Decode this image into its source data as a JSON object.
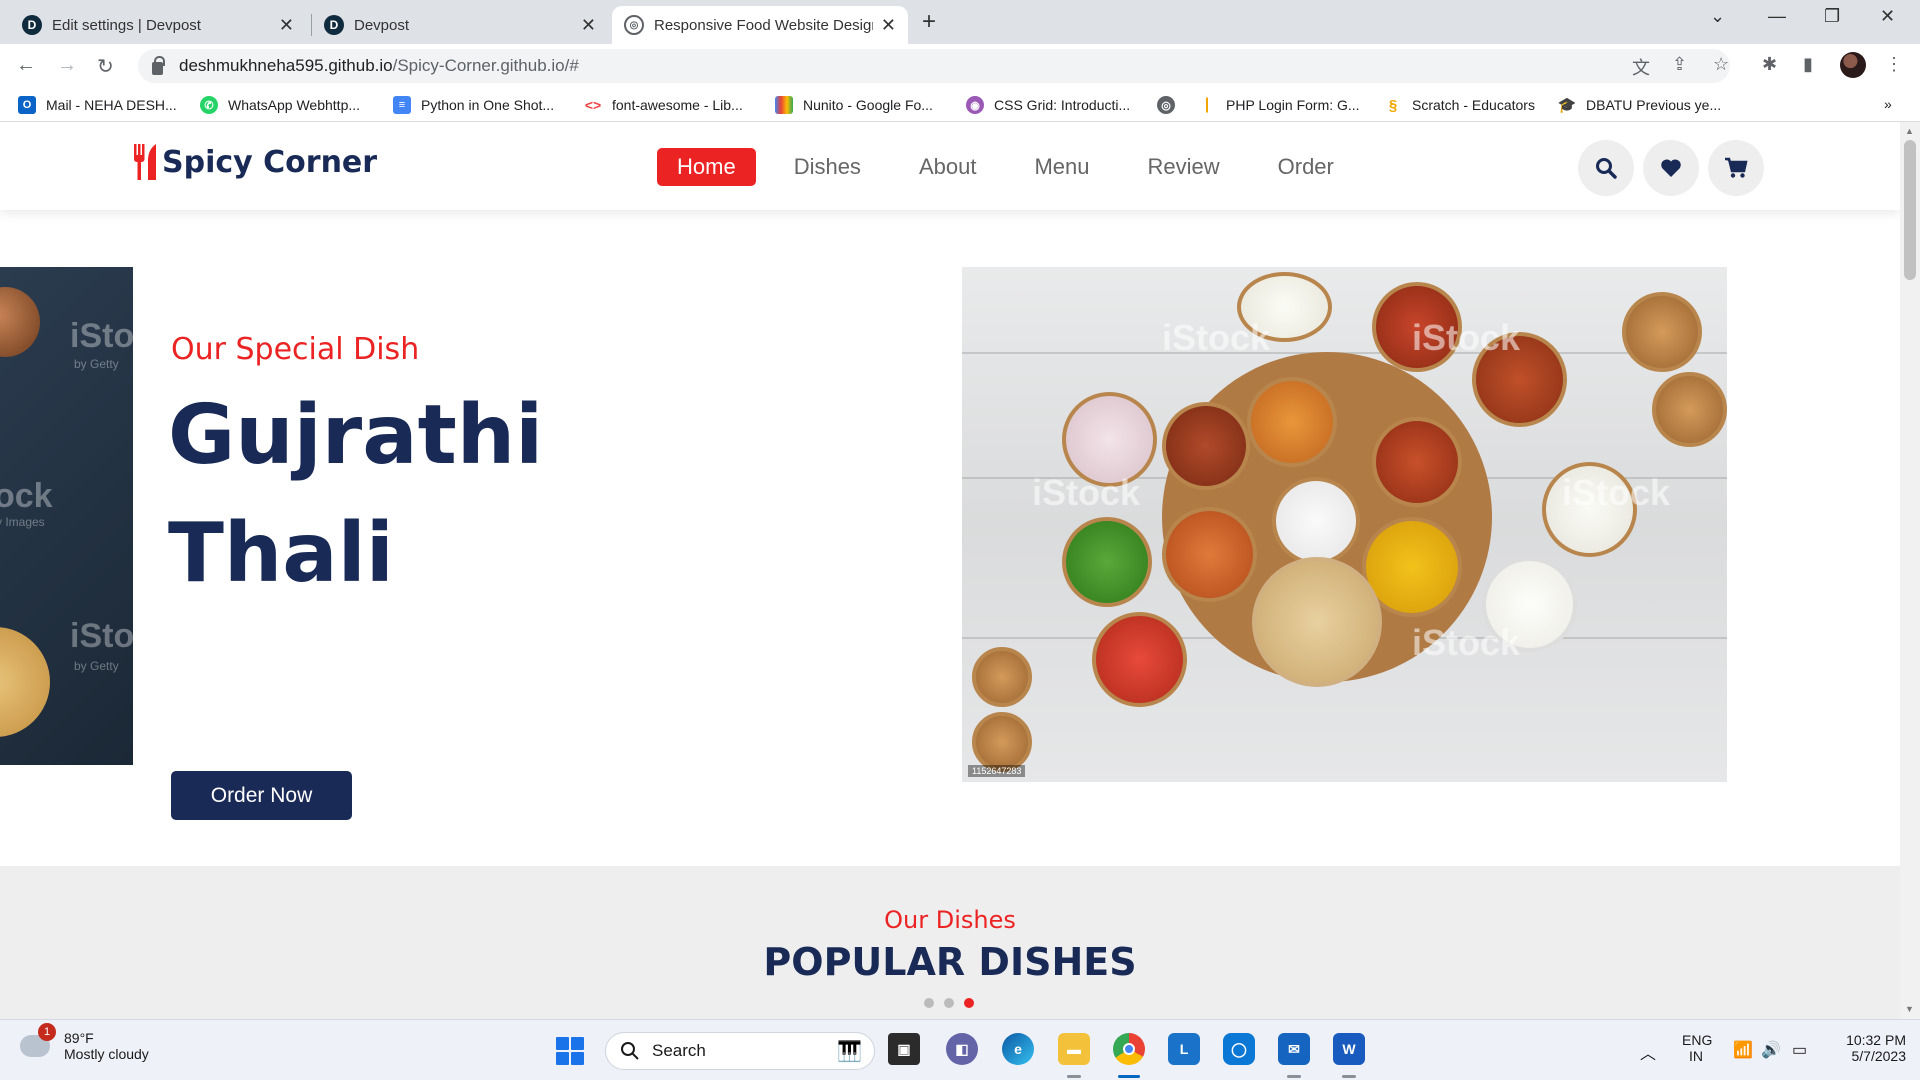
{
  "browser": {
    "tabs": [
      {
        "title": "Edit settings | Devpost",
        "favicon": "D"
      },
      {
        "title": "Devpost",
        "favicon": "D"
      },
      {
        "title": "Responsive Food Website Design",
        "favicon": "globe"
      }
    ],
    "url_host": "deshmukhneha595.github.io",
    "url_path": "/Spicy-Corner.github.io/#",
    "bookmarks": [
      "Mail - NEHA DESH...",
      "WhatsApp Webhttp...",
      "Python in One Shot...",
      "font-awesome - Lib...",
      "Nunito - Google Fo...",
      "CSS Grid: Introducti...",
      "PHP Login Form: G...",
      "Scratch - Educators",
      "DBATU Previous ye..."
    ],
    "more_bookmarks": "»"
  },
  "site": {
    "logo_text": "Spicy Corner",
    "nav": [
      "Home",
      "Dishes",
      "About",
      "Menu",
      "Review",
      "Order"
    ],
    "active_nav": "Home",
    "header_icons": [
      "search-icon",
      "heart-icon",
      "cart-icon"
    ],
    "hero": {
      "subtitle": "Our Special Dish",
      "title_line1": "Gujrathi",
      "title_line2": "Thali",
      "button": "Order Now",
      "prev_watermark": "iStock",
      "prev_watermark_sub": "by Getty",
      "prev_watermark_mid": "ock",
      "prev_watermark_mid_sub": "y Images",
      "image_watermark": "iStock",
      "image_id": "1152647283"
    },
    "dishes": {
      "subtitle": "Our Dishes",
      "title": "POPULAR DISHES",
      "slider_dots": 3,
      "active_dot": 2
    }
  },
  "colors": {
    "brand_red": "#ec2323",
    "brand_navy": "#192a56"
  },
  "taskbar": {
    "weather_temp": "89°F",
    "weather_desc": "Mostly cloudy",
    "weather_badge": "1",
    "search_placeholder": "Search",
    "lang_line1": "ENG",
    "lang_line2": "IN",
    "time": "10:32 PM",
    "date": "5/7/2023"
  }
}
